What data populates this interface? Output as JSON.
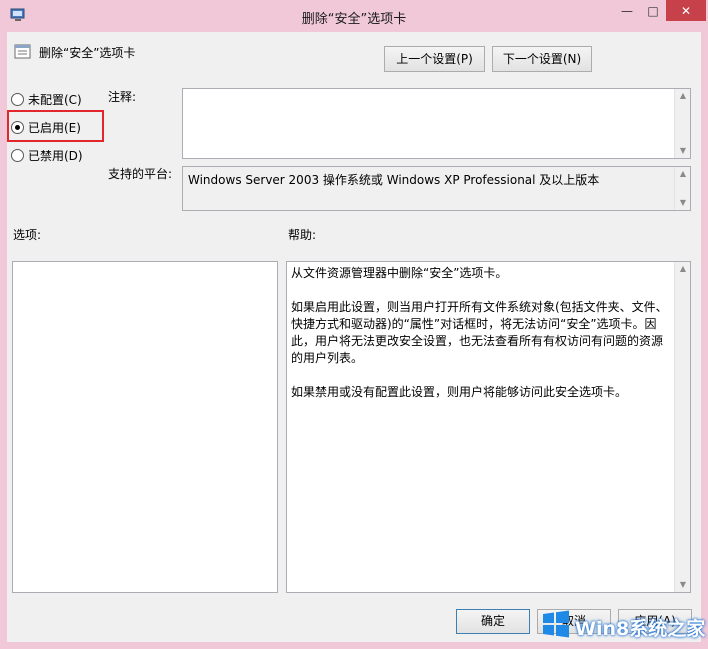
{
  "window": {
    "title": "删除“安全”选项卡",
    "controls": {
      "minimize": "—",
      "maximize": "□",
      "close": "✕"
    }
  },
  "header": {
    "policy_title": "删除“安全”选项卡",
    "prev_button": "上一个设置(P)",
    "next_button": "下一个设置(N)"
  },
  "radios": [
    {
      "label": "未配置(C)",
      "checked": false
    },
    {
      "label": "已启用(E)",
      "checked": true
    },
    {
      "label": "已禁用(D)",
      "checked": false
    }
  ],
  "comment": {
    "label": "注释:",
    "value": ""
  },
  "platform": {
    "label": "支持的平台:",
    "value": "Windows Server 2003 操作系统或 Windows XP Professional 及以上版本"
  },
  "options": {
    "label": "选项:"
  },
  "help": {
    "label": "帮助:",
    "paragraphs": [
      "从文件资源管理器中删除“安全”选项卡。",
      "如果启用此设置，则当用户打开所有文件系统对象(包括文件夹、文件、快捷方式和驱动器)的“属性”对话框时，将无法访问“安全”选项卡。因此，用户将无法更改安全设置，也无法查看所有有权访问有问题的资源的用户列表。",
      "如果禁用或没有配置此设置，则用户将能够访问此安全选项卡。"
    ]
  },
  "footer": {
    "ok_button": "确定",
    "cancel_button": "取消",
    "apply_button": "应用(A)"
  },
  "watermark": {
    "text": "Win8系统之家"
  },
  "colors": {
    "frame": "#f0c8d8",
    "close_button": "#c7414a",
    "highlight_border": "#e1262c",
    "watermark_blue": "#1e6fd1"
  }
}
